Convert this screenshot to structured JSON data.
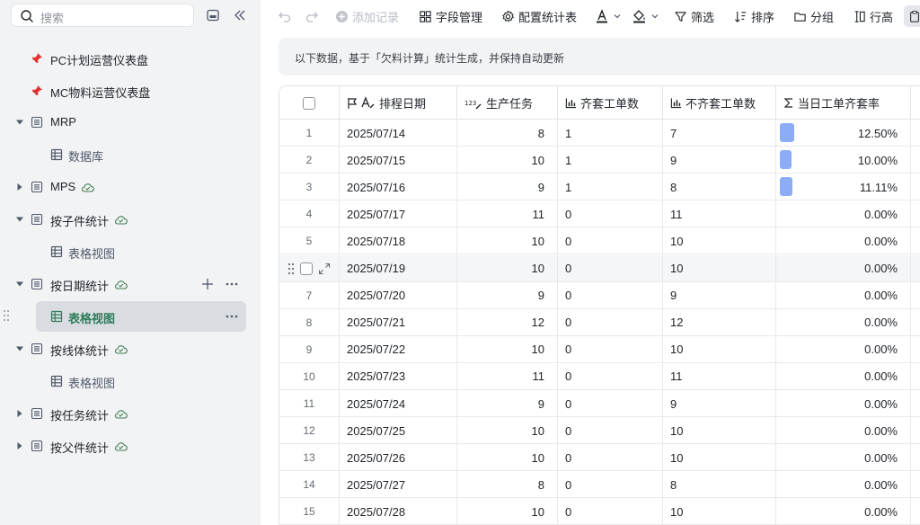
{
  "sidebar": {
    "search_placeholder": "搜索",
    "items": [
      {
        "label": "PC计划运营仪表盘",
        "kind": "pinned"
      },
      {
        "label": "MC物料运营仪表盘",
        "kind": "pinned"
      },
      {
        "label": "MRP",
        "kind": "table",
        "expanded": true
      },
      {
        "label": "数据库",
        "kind": "view"
      },
      {
        "label": "MPS",
        "kind": "table",
        "expanded": false,
        "synced": true
      },
      {
        "label": "按子件统计",
        "kind": "table",
        "expanded": true,
        "synced": true
      },
      {
        "label": "表格视图",
        "kind": "view"
      },
      {
        "label": "按日期统计",
        "kind": "table",
        "expanded": true,
        "synced": true
      },
      {
        "label": "表格视图",
        "kind": "view",
        "active": true
      },
      {
        "label": "按线体统计",
        "kind": "table",
        "expanded": true,
        "synced": true
      },
      {
        "label": "表格视图",
        "kind": "view"
      },
      {
        "label": "按任务统计",
        "kind": "table",
        "expanded": false,
        "synced": true
      },
      {
        "label": "按父件统计",
        "kind": "table",
        "expanded": false,
        "synced": true
      }
    ]
  },
  "toolbar": {
    "add_record": "添加记录",
    "field_manage": "字段管理",
    "config_stats": "配置统计表",
    "filter": "筛选",
    "sort": "排序",
    "group": "分组",
    "row_height": "行高"
  },
  "notice": "以下数据，基于「欠料计算」统计生成，并保持自动更新",
  "table": {
    "columns": [
      "排程日期",
      "生产任务",
      "齐套工单数",
      "不齐套工单数",
      "当日工单齐套率"
    ],
    "hover_row_index": 5,
    "rows": [
      {
        "idx": "1",
        "date": "2025/07/14",
        "task": "8",
        "full": "1",
        "notfull": "7",
        "rate": "12.50%",
        "rate_value": 0.125
      },
      {
        "idx": "2",
        "date": "2025/07/15",
        "task": "10",
        "full": "1",
        "notfull": "9",
        "rate": "10.00%",
        "rate_value": 0.1
      },
      {
        "idx": "3",
        "date": "2025/07/16",
        "task": "9",
        "full": "1",
        "notfull": "8",
        "rate": "11.11%",
        "rate_value": 0.1111
      },
      {
        "idx": "4",
        "date": "2025/07/17",
        "task": "11",
        "full": "0",
        "notfull": "11",
        "rate": "0.00%",
        "rate_value": 0
      },
      {
        "idx": "5",
        "date": "2025/07/18",
        "task": "10",
        "full": "0",
        "notfull": "10",
        "rate": "0.00%",
        "rate_value": 0
      },
      {
        "idx": "6",
        "date": "2025/07/19",
        "task": "10",
        "full": "0",
        "notfull": "10",
        "rate": "0.00%",
        "rate_value": 0
      },
      {
        "idx": "7",
        "date": "2025/07/20",
        "task": "9",
        "full": "0",
        "notfull": "9",
        "rate": "0.00%",
        "rate_value": 0
      },
      {
        "idx": "8",
        "date": "2025/07/21",
        "task": "12",
        "full": "0",
        "notfull": "12",
        "rate": "0.00%",
        "rate_value": 0
      },
      {
        "idx": "9",
        "date": "2025/07/22",
        "task": "10",
        "full": "0",
        "notfull": "10",
        "rate": "0.00%",
        "rate_value": 0
      },
      {
        "idx": "10",
        "date": "2025/07/23",
        "task": "11",
        "full": "0",
        "notfull": "11",
        "rate": "0.00%",
        "rate_value": 0
      },
      {
        "idx": "11",
        "date": "2025/07/24",
        "task": "9",
        "full": "0",
        "notfull": "9",
        "rate": "0.00%",
        "rate_value": 0
      },
      {
        "idx": "12",
        "date": "2025/07/25",
        "task": "10",
        "full": "0",
        "notfull": "10",
        "rate": "0.00%",
        "rate_value": 0
      },
      {
        "idx": "13",
        "date": "2025/07/26",
        "task": "10",
        "full": "0",
        "notfull": "10",
        "rate": "0.00%",
        "rate_value": 0
      },
      {
        "idx": "14",
        "date": "2025/07/27",
        "task": "8",
        "full": "0",
        "notfull": "8",
        "rate": "0.00%",
        "rate_value": 0
      },
      {
        "idx": "15",
        "date": "2025/07/28",
        "task": "10",
        "full": "0",
        "notfull": "10",
        "rate": "0.00%",
        "rate_value": 0
      }
    ]
  },
  "colors": {
    "accent_green": "#2e7d5b",
    "rate_bar": "#8cadf5",
    "pin_red": "#e0302f",
    "synced_green": "#3f7d4f"
  }
}
